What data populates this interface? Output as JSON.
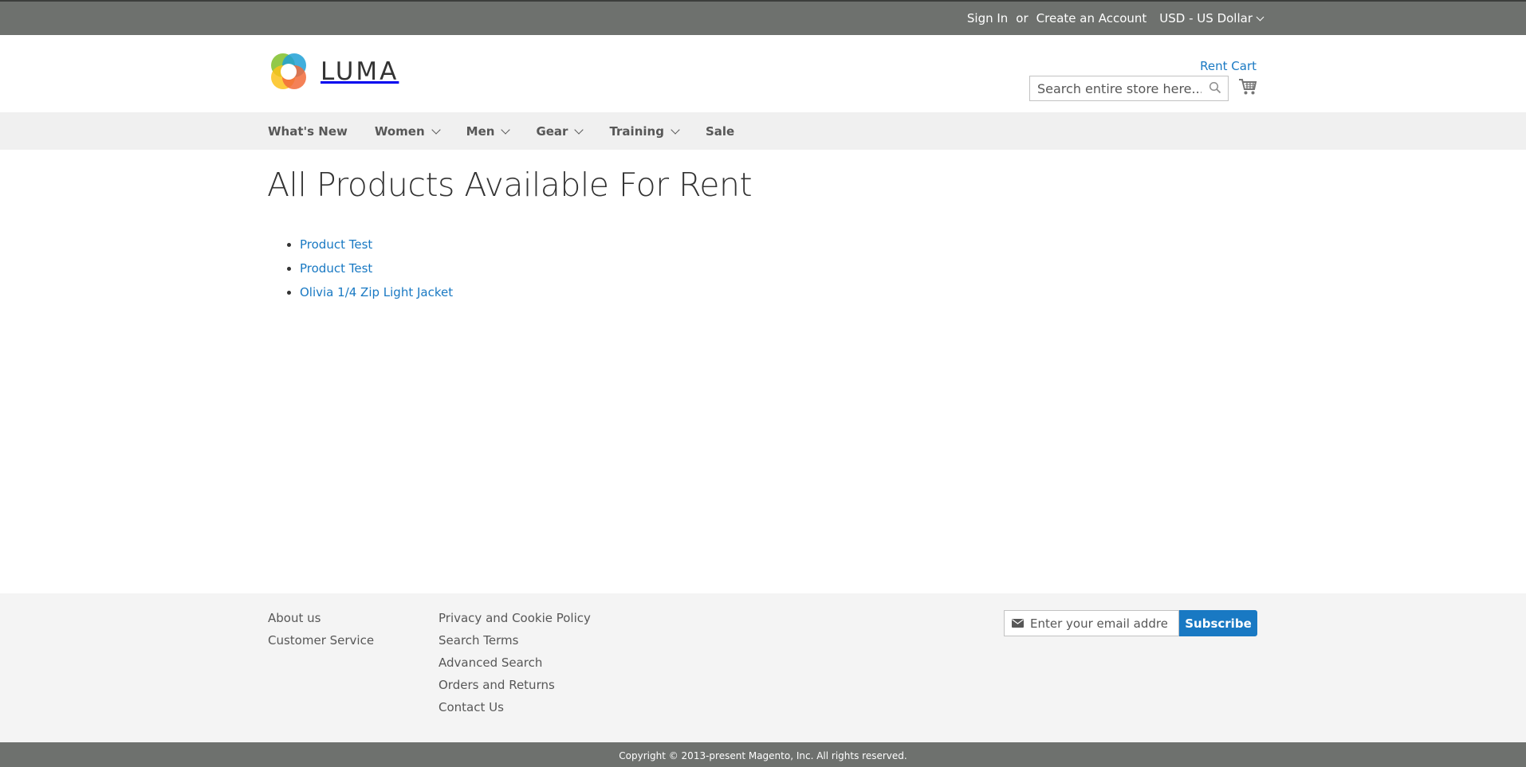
{
  "top_links": {
    "sign_in": "Sign In",
    "or": "or",
    "create_account": "Create an Account",
    "currency": "USD - US Dollar"
  },
  "header": {
    "logo_text": "LUMA",
    "rent_cart": "Rent Cart",
    "search_placeholder": "Search entire store here..."
  },
  "nav": {
    "items": [
      {
        "label": "What's New",
        "has_dropdown": false
      },
      {
        "label": "Women",
        "has_dropdown": true
      },
      {
        "label": "Men",
        "has_dropdown": true
      },
      {
        "label": "Gear",
        "has_dropdown": true
      },
      {
        "label": "Training",
        "has_dropdown": true
      },
      {
        "label": "Sale",
        "has_dropdown": false
      }
    ]
  },
  "main": {
    "title": "All Products Available For Rent",
    "products": [
      "Product Test",
      "Product Test",
      "Olivia 1/4 Zip Light Jacket"
    ]
  },
  "footer": {
    "col1": [
      "About us",
      "Customer Service"
    ],
    "col2": [
      "Privacy and Cookie Policy",
      "Search Terms",
      "Advanced Search",
      "Orders and Returns",
      "Contact Us"
    ],
    "newsletter_placeholder": "Enter your email address",
    "subscribe_label": "Subscribe",
    "copyright": "Copyright © 2013-present Magento, Inc. All rights reserved."
  },
  "colors": {
    "top_bar": "#6e716e",
    "link_blue": "#1979c3",
    "nav_bg": "#f0f0f0",
    "footer_bg": "#f4f4f4"
  },
  "icons": {
    "search": "search-icon",
    "cart": "cart-icon",
    "mail": "mail-icon",
    "logo": "luma-logo-icon"
  }
}
